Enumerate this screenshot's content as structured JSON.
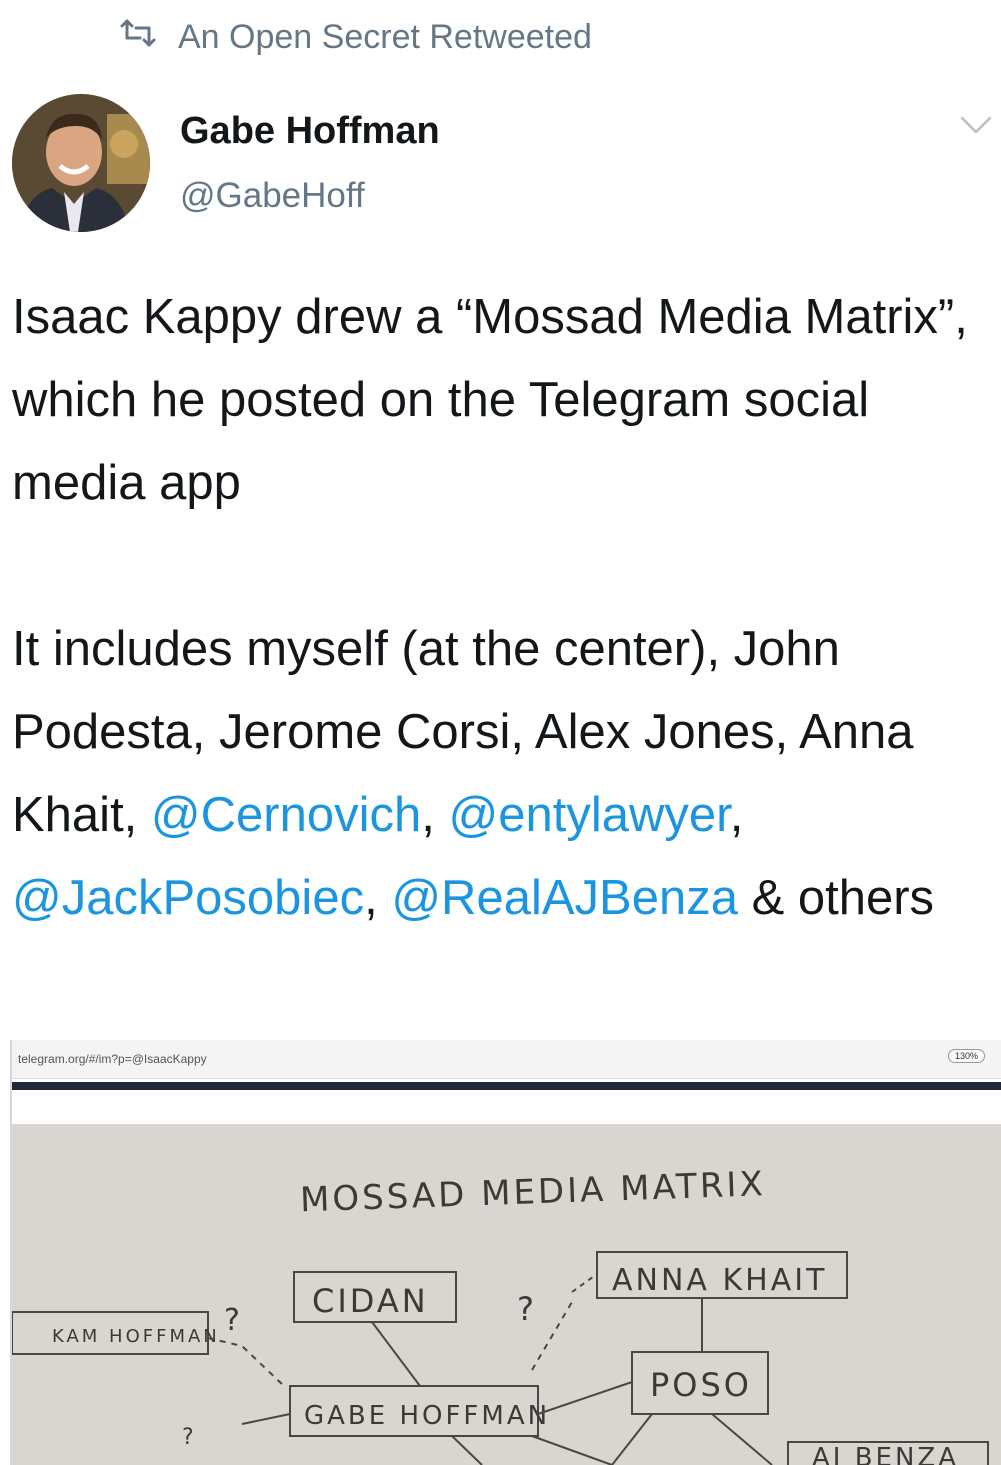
{
  "retweet": {
    "icon": "retweet-icon",
    "text": "An Open Secret Retweeted"
  },
  "author": {
    "name": "Gabe Hoffman",
    "handle": "@GabeHoff",
    "avatar_icon": "avatar-photo"
  },
  "tweet": {
    "paragraph1": "Isaac Kappy drew a “Mossad Media Matrix”, which he posted on the Telegram social media app",
    "paragraph2_intro": "It includes myself (at the center), John Podesta, Jerome Corsi, Alex Jones, Anna Khait, ",
    "mentions": [
      "@Cernovich",
      "@entylawyer",
      "@JackPosobiec",
      "@RealAJBenza"
    ],
    "sep1": ", ",
    "sep2": ", ",
    "sep3": ", ",
    "outro": " & others"
  },
  "photo": {
    "url": "telegram.org/#/im?p=@IsaacKappy",
    "zoom": "130%",
    "drawing": {
      "title": "MOSSAD MEDIA MATRIX",
      "nodes": [
        "CIDAN",
        "ANNA KHAIT",
        "KAM HOFFMAN",
        "GABE HOFFMAN",
        "POSO",
        "AJ BENZA"
      ],
      "marks": [
        "?",
        "?",
        "?"
      ]
    }
  },
  "colors": {
    "text": "#14171a",
    "secondary": "#657786",
    "link": "#1b95e0"
  }
}
